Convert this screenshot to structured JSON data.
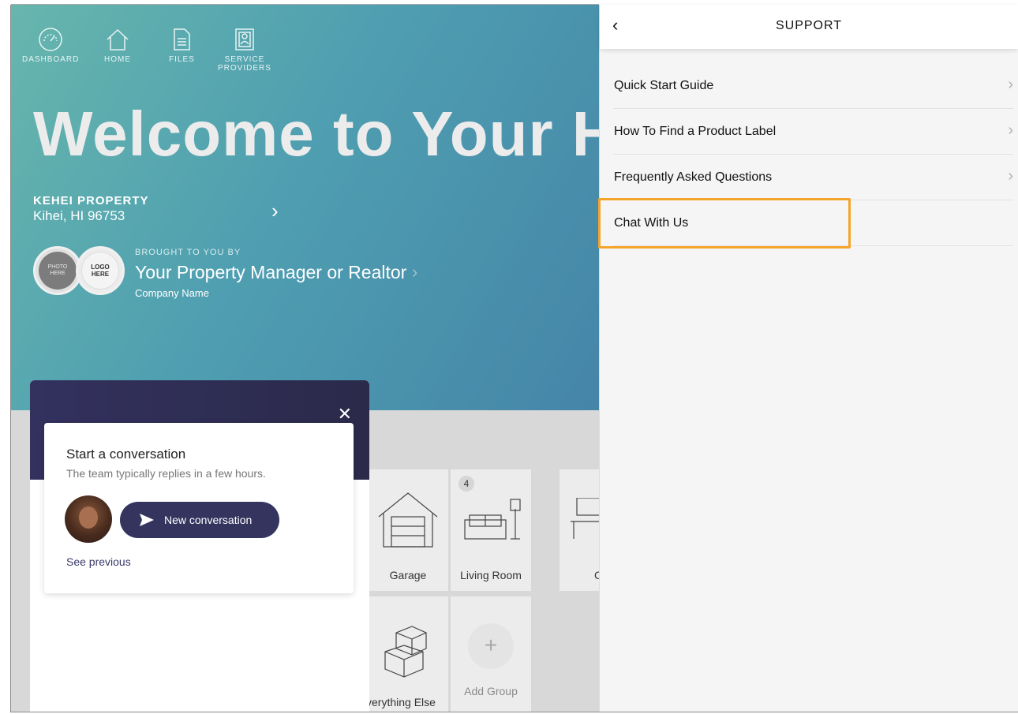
{
  "nav": {
    "dashboard": "DASHBOARD",
    "home": "HOME",
    "files": "FILES",
    "service_providers_1": "SERVICE",
    "service_providers_2": "PROVIDERS"
  },
  "hero": {
    "welcome": "Welcome to Your Hor",
    "property_name": "KEHEI PROPERTY",
    "property_address": "Kihei, HI 96753",
    "photo_1": "PHOTO",
    "photo_2": "HERE",
    "logo_1": "LOGO",
    "logo_2": "HERE",
    "brought_by": "BROUGHT TO YOU BY",
    "manager": "Your Property Manager or Realtor",
    "company": "Company Name"
  },
  "groups": {
    "garage": "Garage",
    "living_room": "Living Room",
    "living_room_badge": "4",
    "partial_c": "C",
    "everything_else": "verything Else",
    "add_group": "Add Group",
    "add_symbol": "+"
  },
  "chat": {
    "close": "✕",
    "title": "Start a conversation",
    "subtitle": "The team typically replies in a few hours.",
    "new_conversation": "New conversation",
    "see_previous": "See previous"
  },
  "support": {
    "back": "‹",
    "title": "SUPPORT",
    "items": [
      {
        "label": "Quick Start Guide",
        "chevron": "›"
      },
      {
        "label": "How To Find a Product Label",
        "chevron": "›"
      },
      {
        "label": "Frequently Asked Questions",
        "chevron": "›"
      },
      {
        "label": "Chat With Us",
        "chevron": ""
      }
    ]
  },
  "colors": {
    "highlight": "#f4a52a",
    "chat_brand": "#35345f",
    "hero_start": "#67b6ad",
    "hero_end": "#4585a8"
  },
  "icons": [
    "dashboard-gauge-icon",
    "home-icon",
    "files-icon",
    "service-providers-icon",
    "chevron-right-icon",
    "close-icon",
    "send-icon",
    "garage-icon",
    "sofa-icon",
    "desk-icon",
    "boxes-icon",
    "plus-icon",
    "back-chevron-icon"
  ]
}
